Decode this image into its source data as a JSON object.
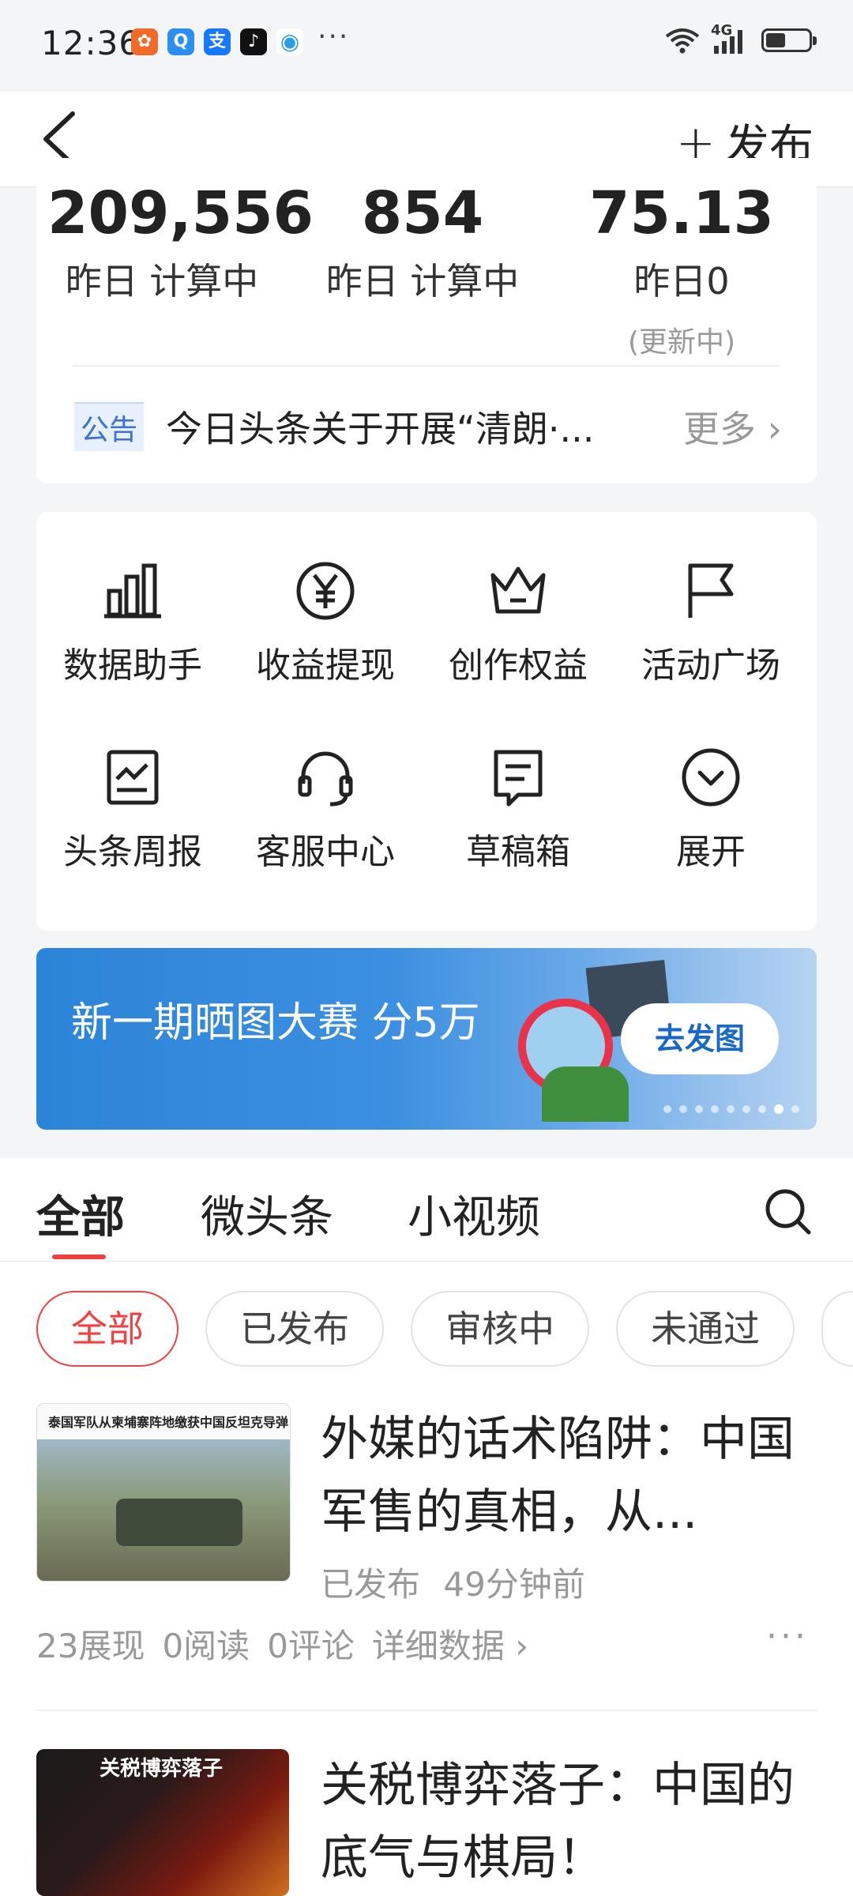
{
  "status": {
    "time": "12:36",
    "network": "4G",
    "more": "···"
  },
  "nav": {
    "publish_label": "发布"
  },
  "stats": [
    {
      "value": "209,556",
      "sub": "昨日 计算中"
    },
    {
      "value": "854",
      "sub": "昨日 计算中"
    },
    {
      "value": "75.13",
      "sub": "昨日0",
      "note": "(更新中)"
    }
  ],
  "notice": {
    "tag": "公告",
    "text": "今日头条关于开展“清朗·...",
    "more": "更多"
  },
  "tools": [
    {
      "label": "数据助手",
      "icon": "bar-chart-icon"
    },
    {
      "label": "收益提现",
      "icon": "yuan-icon"
    },
    {
      "label": "创作权益",
      "icon": "crown-icon"
    },
    {
      "label": "活动广场",
      "icon": "flag-icon"
    },
    {
      "label": "头条周报",
      "icon": "weekly-report-icon"
    },
    {
      "label": "客服中心",
      "icon": "headset-icon"
    },
    {
      "label": "草稿箱",
      "icon": "draft-icon"
    },
    {
      "label": "展开",
      "icon": "expand-icon"
    }
  ],
  "banner": {
    "title": "新一期晒图大赛 分5万",
    "button": "去发图",
    "active_dot": 8,
    "dot_count": 9
  },
  "tabs": [
    "全部",
    "微头条",
    "小视频"
  ],
  "filters": [
    "全部",
    "已发布",
    "审核中",
    "未通过"
  ],
  "articles": [
    {
      "thumb_caption": "泰国军队从柬埔寨阵地缴获中国反坦克导弹",
      "title": "外媒的话术陷阱：中国军售的真相，从...",
      "status": "已发布",
      "time": "49分钟前",
      "impressions": "23展现",
      "reads": "0阅读",
      "comments": "0评论",
      "details": "详细数据"
    },
    {
      "thumb_caption": "关税博弈落子",
      "title": "关税博弈落子：中国的底气与棋局！"
    }
  ],
  "colors": {
    "accent": "#f04142",
    "notice_tag": "#3a70d8",
    "banner_blue": "#2c84d8"
  }
}
